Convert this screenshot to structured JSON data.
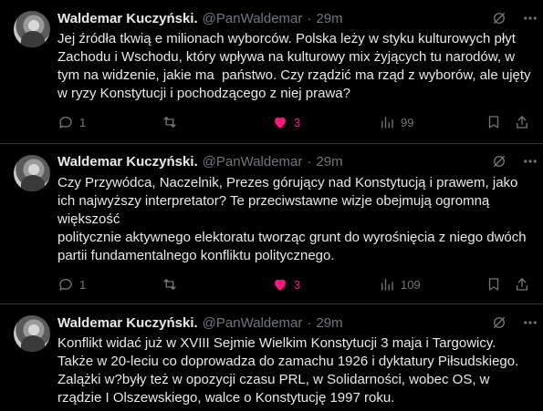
{
  "colors": {
    "background": "#000000",
    "text": "#e7e9ea",
    "muted": "#71767b",
    "like": "#f91880",
    "divider": "#2f3336"
  },
  "tweets": [
    {
      "author_name": "Waldemar Kuczyński.",
      "handle": "@PanWaldemar",
      "separator": "·",
      "time": "29m",
      "text": "Jej źródła tkwią e milionach wyborców. Polska leży w styku kulturowych płyt Zachodu i Wschodu, który wpływa na kulturowy mix żyjących tu narodów, w tym na widzenie, jakie ma  państwo. Czy rządzić ma rząd z wyborów, ale ujęty w ryzy Konstytucji i pochodzącego z niej prawa?",
      "replies": "1",
      "retweets": "",
      "likes": "3",
      "views": "99",
      "liked": true
    },
    {
      "author_name": "Waldemar Kuczyński.",
      "handle": "@PanWaldemar",
      "separator": "·",
      "time": "29m",
      "text": "Czy Przywódca, Naczelnik, Prezes górujący nad Konstytucją i prawem, jako ich najwyższy interpretator? Te przeciwstawne wizje obejmują ogromną większość\npolitycznie aktywnego elektoratu tworząc grunt do wyrośnięcia z niego dwóch partii fundamentalnego konfliktu politycznego.",
      "replies": "1",
      "retweets": "",
      "likes": "3",
      "views": "109",
      "liked": true
    },
    {
      "author_name": "Waldemar Kuczyński.",
      "handle": "@PanWaldemar",
      "separator": "·",
      "time": "29m",
      "text": "Konflikt widać już w XVIII Sejmie Wielkim Konstytucji 3 maja i Targowicy. Także w 20-leciu co doprowadza do zamachu 1926 i dyktatury Piłsudskiego. Zalążki w?były też w opozycji czasu PRL, w Solidarności, wobec OS, w rządzie I Olszewskiego, walce o Konstytucję 1997 roku."
    }
  ]
}
